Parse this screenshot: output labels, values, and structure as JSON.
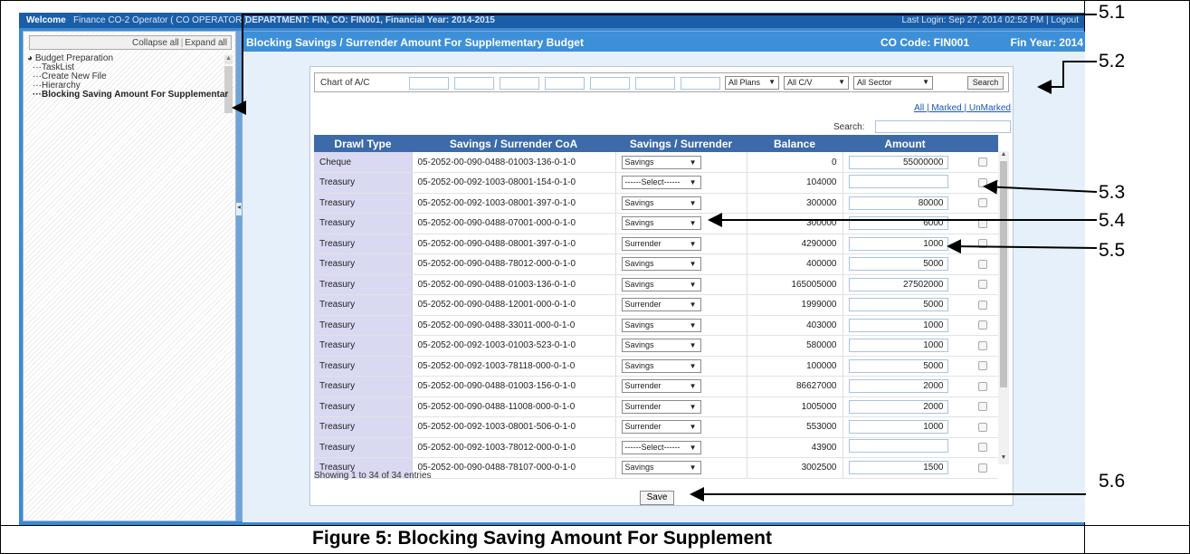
{
  "topbar": {
    "welcome": "Welcome",
    "user": "Finance CO-2 Operator ( CO OPERATOR )",
    "department": "DEPARTMENT: FIN, CO: FIN001, Financial Year: 2014-2015",
    "last_login": "Last Login: Sep 27, 2014 02:52 PM  |  Logout"
  },
  "sidebar": {
    "collapse_all": "Collapse all",
    "expand_all": "Expand all",
    "root": "Budget Preparation",
    "items": [
      {
        "label": "TaskList"
      },
      {
        "label": "Create New File"
      },
      {
        "label": "Hierarchy"
      },
      {
        "label": "Blocking Saving Amount For Supplementar"
      }
    ]
  },
  "main": {
    "title": "Blocking Savings / Surrender Amount For Supplementary Budget",
    "co_code": "CO Code: FIN001",
    "fin_year": "Fin Year: 2014"
  },
  "filters": {
    "chart_label": "Chart of A/C",
    "plans": "All Plans",
    "cv": "All C/V",
    "sector": "All Sector",
    "search_button": "Search"
  },
  "links": {
    "all": "All",
    "marked": "Marked",
    "unmarked": "UnMarked"
  },
  "search_label": "Search:",
  "table": {
    "headers": [
      "Drawl Type",
      "Savings / Surrender CoA",
      "Savings / Surrender",
      "Balance",
      "Amount"
    ],
    "rows": [
      {
        "type": "Cheque",
        "coa": "05-2052-00-090-0488-01003-136-0-1-0",
        "choice": "Savings",
        "balance": "0",
        "amount": "55000000"
      },
      {
        "type": "Treasury",
        "coa": "05-2052-00-092-1003-08001-154-0-1-0",
        "choice": "------Select------",
        "balance": "104000",
        "amount": ""
      },
      {
        "type": "Treasury",
        "coa": "05-2052-00-092-1003-08001-397-0-1-0",
        "choice": "Savings",
        "balance": "300000",
        "amount": "80000"
      },
      {
        "type": "Treasury",
        "coa": "05-2052-00-090-0488-07001-000-0-1-0",
        "choice": "Savings",
        "balance": "300000",
        "amount": "6000"
      },
      {
        "type": "Treasury",
        "coa": "05-2052-00-090-0488-08001-397-0-1-0",
        "choice": "Surrender",
        "balance": "4290000",
        "amount": "1000"
      },
      {
        "type": "Treasury",
        "coa": "05-2052-00-090-0488-78012-000-0-1-0",
        "choice": "Savings",
        "balance": "400000",
        "amount": "5000"
      },
      {
        "type": "Treasury",
        "coa": "05-2052-00-090-0488-01003-136-0-1-0",
        "choice": "Savings",
        "balance": "165005000",
        "amount": "27502000"
      },
      {
        "type": "Treasury",
        "coa": "05-2052-00-090-0488-12001-000-0-1-0",
        "choice": "Surrender",
        "balance": "1999000",
        "amount": "5000"
      },
      {
        "type": "Treasury",
        "coa": "05-2052-00-090-0488-33011-000-0-1-0",
        "choice": "Savings",
        "balance": "403000",
        "amount": "1000"
      },
      {
        "type": "Treasury",
        "coa": "05-2052-00-092-1003-01003-523-0-1-0",
        "choice": "Savings",
        "balance": "580000",
        "amount": "1000"
      },
      {
        "type": "Treasury",
        "coa": "05-2052-00-092-1003-78118-000-0-1-0",
        "choice": "Savings",
        "balance": "100000",
        "amount": "5000"
      },
      {
        "type": "Treasury",
        "coa": "05-2052-00-090-0488-01003-156-0-1-0",
        "choice": "Surrender",
        "balance": "86627000",
        "amount": "2000"
      },
      {
        "type": "Treasury",
        "coa": "05-2052-00-090-0488-11008-000-0-1-0",
        "choice": "Surrender",
        "balance": "1005000",
        "amount": "2000"
      },
      {
        "type": "Treasury",
        "coa": "05-2052-00-092-1003-08001-506-0-1-0",
        "choice": "Surrender",
        "balance": "553000",
        "amount": "1000"
      },
      {
        "type": "Treasury",
        "coa": "05-2052-00-092-1003-78012-000-0-1-0",
        "choice": "------Select------",
        "balance": "43900",
        "amount": ""
      },
      {
        "type": "Treasury",
        "coa": "05-2052-00-090-0488-78107-000-0-1-0",
        "choice": "Savings",
        "balance": "3002500",
        "amount": "1500"
      }
    ]
  },
  "showing": "Showing 1 to 34 of 34 entries",
  "save_button": "Save",
  "callouts": [
    "5.1",
    "5.2",
    "5.3",
    "5.4",
    "5.5",
    "5.6"
  ],
  "caption": "Figure 5: Blocking Saving Amount For Supplement"
}
